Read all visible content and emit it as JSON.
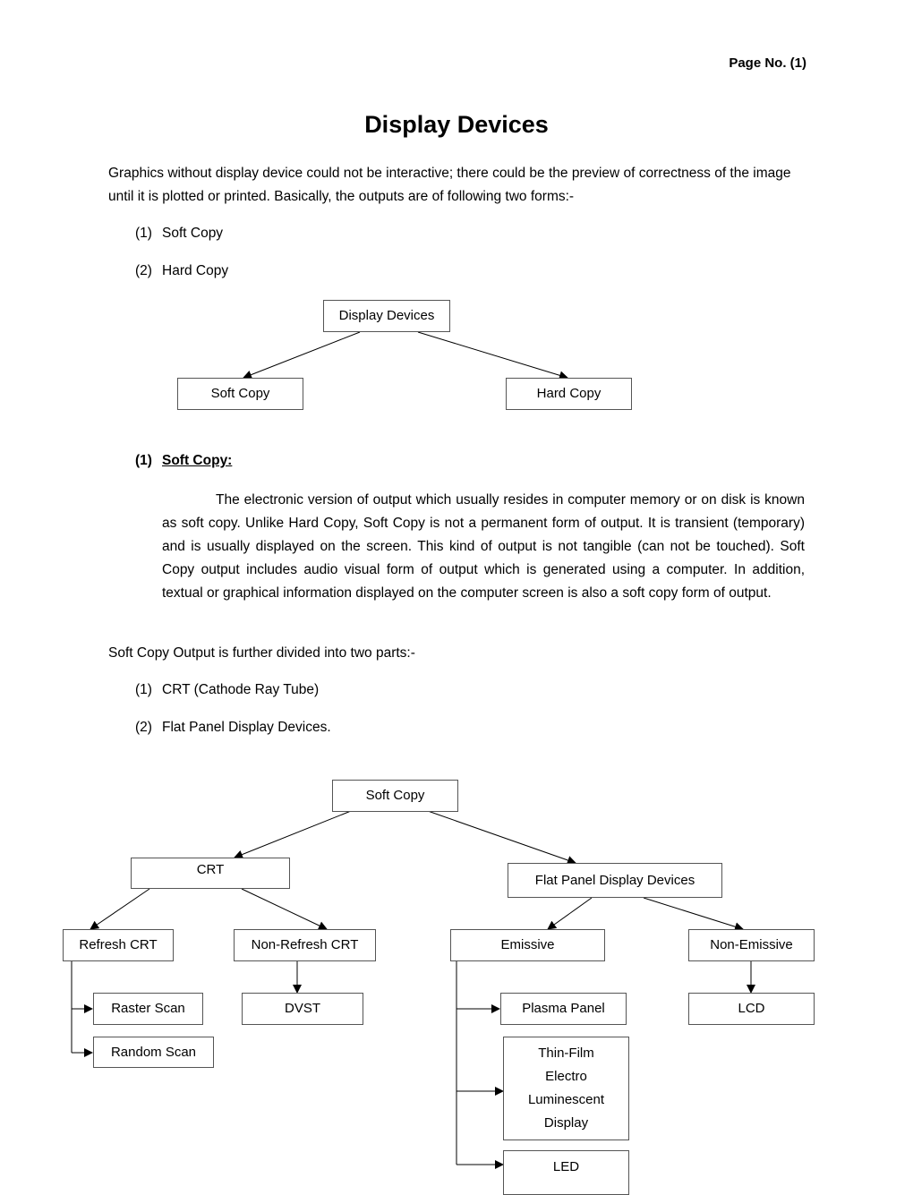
{
  "page_number": "Page No. (1)",
  "title": "Display Devices",
  "intro": "Graphics without display device could not be interactive; there could be the preview of correctness of the image until it is plotted or printed. Basically, the outputs are of following two forms:-",
  "output_forms": [
    {
      "num": "(1)",
      "label": "Soft Copy"
    },
    {
      "num": "(2)",
      "label": "Hard Copy"
    }
  ],
  "diagram1": {
    "root": "Display Devices",
    "children": [
      "Soft Copy",
      "Hard Copy"
    ]
  },
  "section1": {
    "num": "(1)",
    "heading": "Soft Copy:",
    "paragraph": "The electronic version of output which usually resides in computer memory or on disk is known as soft copy. Unlike Hard Copy, Soft Copy is not a permanent form of output. It is transient (temporary) and is usually displayed on the screen. This kind of output is not tangible (can not be touched). Soft Copy output includes audio visual form of output which is generated using a computer. In addition, textual or graphical information displayed on the computer screen is also a soft copy form of output."
  },
  "division_intro": "Soft Copy Output is further divided into two parts:-",
  "soft_copy_parts": [
    {
      "num": "(1)",
      "label": "CRT (Cathode Ray Tube)"
    },
    {
      "num": "(2)",
      "label": "Flat Panel Display Devices."
    }
  ],
  "diagram2": {
    "root": "Soft Copy",
    "crt": "CRT",
    "flat_panel": "Flat Panel Display Devices",
    "refresh_crt": "Refresh CRT",
    "non_refresh_crt": "Non-Refresh CRT",
    "raster_scan": "Raster Scan",
    "random_scan": "Random Scan",
    "dvst": "DVST",
    "emissive": "Emissive",
    "non_emissive": "Non-Emissive",
    "plasma_panel": "Plasma Panel",
    "tfel": [
      "Thin-Film",
      "Electro",
      "Luminescent",
      "Display"
    ],
    "led": "LED",
    "lcd": "LCD"
  }
}
